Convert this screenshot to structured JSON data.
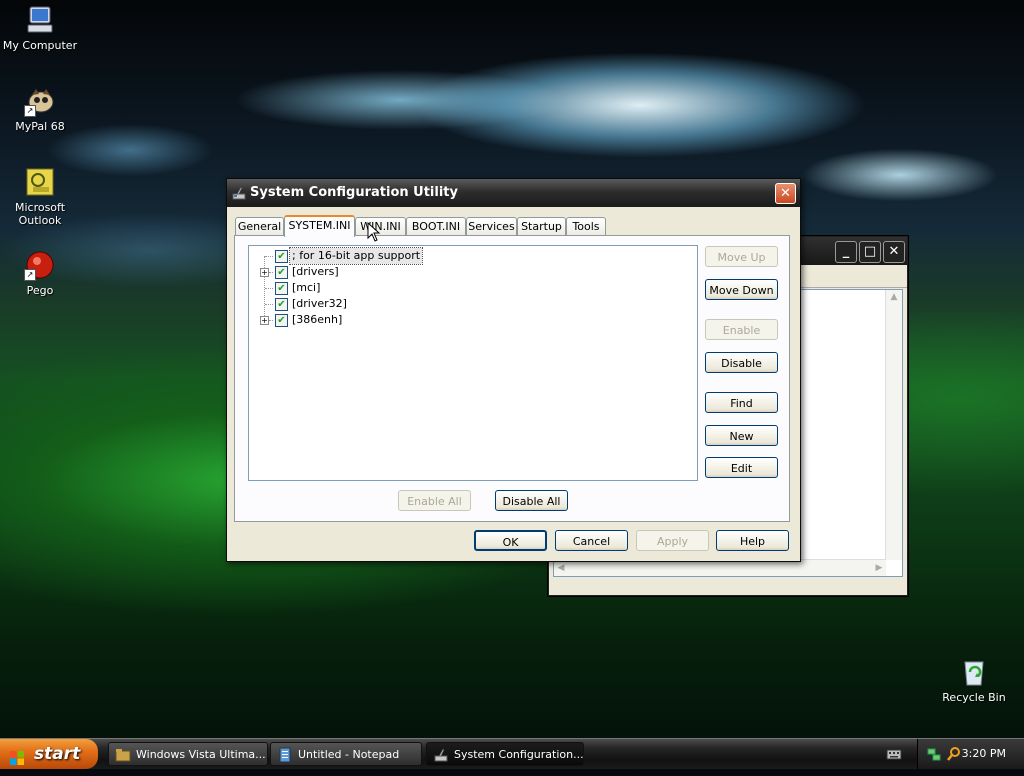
{
  "desktop": {
    "icons": [
      {
        "label": "My Computer"
      },
      {
        "label": "MyPal 68"
      },
      {
        "label": "Microsoft Outlook"
      },
      {
        "label": "Pego"
      },
      {
        "label": "Recycle Bin"
      }
    ]
  },
  "dialog": {
    "title": "System Configuration Utility",
    "tabs": [
      {
        "label": "General"
      },
      {
        "label": "SYSTEM.INI",
        "active": true
      },
      {
        "label": "WIN.INI"
      },
      {
        "label": "BOOT.INI"
      },
      {
        "label": "Services"
      },
      {
        "label": "Startup"
      },
      {
        "label": "Tools"
      }
    ],
    "tree": [
      {
        "label": "; for 16-bit app support",
        "checked": true,
        "expandable": false,
        "selected": true
      },
      {
        "label": "[drivers]",
        "checked": true,
        "expandable": true
      },
      {
        "label": "[mci]",
        "checked": true,
        "expandable": false
      },
      {
        "label": "[driver32]",
        "checked": true,
        "expandable": false
      },
      {
        "label": "[386enh]",
        "checked": true,
        "expandable": true
      }
    ],
    "side_buttons": {
      "move_up": "Move Up",
      "move_down": "Move Down",
      "enable": "Enable",
      "disable": "Disable",
      "find": "Find",
      "new": "New",
      "edit": "Edit"
    },
    "enable_all": "Enable All",
    "disable_all": "Disable All",
    "footer": {
      "ok": "OK",
      "cancel": "Cancel",
      "apply": "Apply",
      "help": "Help"
    },
    "close_glyph": "✕"
  },
  "notepad": {
    "min_glyph": "_",
    "max_glyph": "□",
    "close_glyph": "✕"
  },
  "taskbar": {
    "start_label": "start",
    "tasks": [
      {
        "label": "Windows Vista Ultima..."
      },
      {
        "label": "Untitled - Notepad"
      },
      {
        "label": "System Configuration...",
        "active": true
      }
    ],
    "clock": "3:20 PM"
  },
  "colors": {
    "active_tab_accent": "#e68b2c",
    "check_green": "#21a121",
    "close_red": "#c9481f",
    "start_orange": "#e2701a"
  }
}
